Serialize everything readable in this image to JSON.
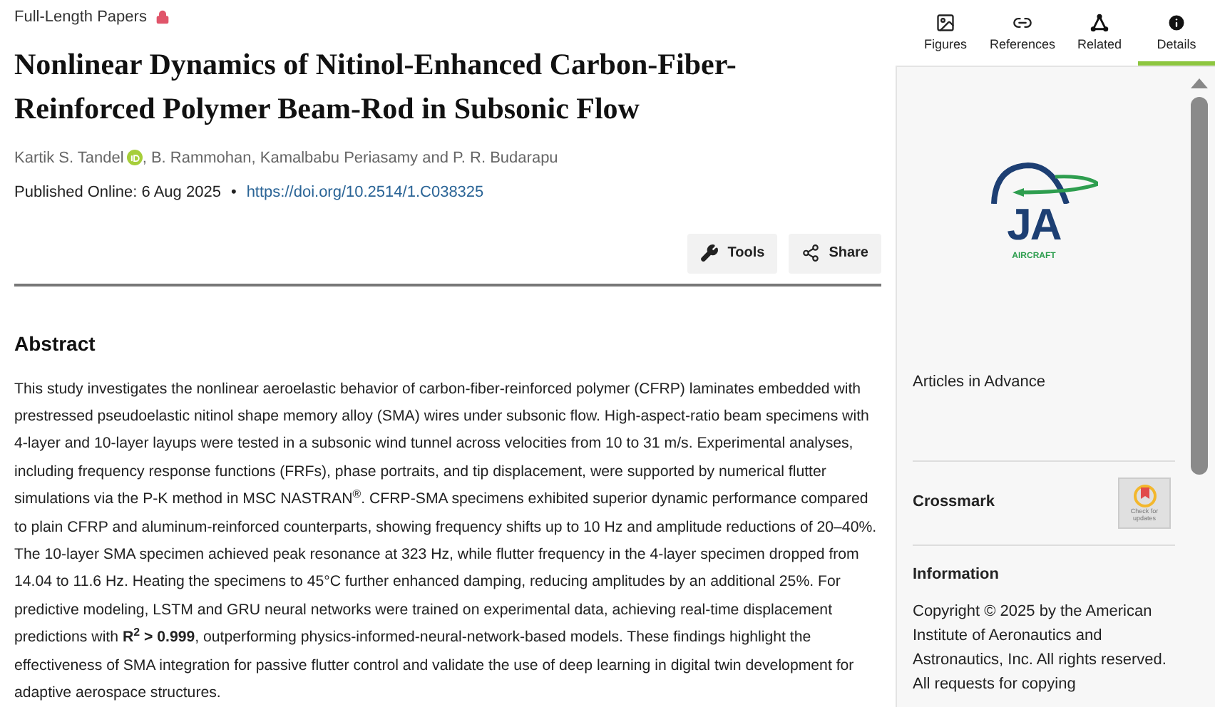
{
  "article": {
    "section": "Full-Length Papers",
    "locked": true,
    "title": "Nonlinear Dynamics of Nitinol-Enhanced Carbon-Fiber-Reinforced Polymer Beam-Rod in Subsonic Flow",
    "authors": [
      {
        "text": "Kartik S. Tandel",
        "orcid": true
      },
      {
        "text": ", B. Rammohan, Kamalbabu Periasamy and P. R. Budarapu",
        "orcid": false
      }
    ],
    "published": "Published Online: 6 Aug 2025",
    "separator": "•",
    "doi": "https://doi.org/10.2514/1.C038325",
    "actions": [
      {
        "label": "Tools",
        "kind": "wrench"
      },
      {
        "label": "Share",
        "kind": "share"
      }
    ],
    "abstract_heading": "Abstract",
    "abstract": "This study investigates the nonlinear aeroelastic behavior of carbon-fiber-reinforced polymer (CFRP) laminates embedded with prestressed pseudoelastic nitinol shape memory alloy (SMA) wires under subsonic flow. High-aspect-ratio beam specimens with 4-layer and 10-layer layups were tested in a subsonic wind tunnel across velocities from 10 to 31 m/s. Experimental analyses, including frequency response functions (FRFs), phase portraits, and tip displacement, were supported by numerical flutter simulations via the P-K method in MSC NASTRAN$^{®}$. CFRP-SMA specimens exhibited superior dynamic performance compared to plain CFRP and aluminum-reinforced counterparts, showing frequency shifts up to 10 Hz and amplitude reductions of 20–40%. The 10-layer SMA specimen achieved peak resonance at 323 Hz, while flutter frequency in the 4-layer specimen dropped from 14.04 to 11.6 Hz. Heating the specimens to 45°C further enhanced damping, reducing amplitudes by an additional 25%. For predictive modeling, LSTM and GRU neural networks were trained on experimental data, achieving real-time displacement predictions with **R$^{2}$ > 0.999**, outperforming physics-informed-neural-network-based models. These findings highlight the effectiveness of SMA integration for passive flutter control and validate the use of deep learning in digital twin development for adaptive aerospace structures."
  },
  "sidebar": {
    "tabs": [
      {
        "label": "Figures",
        "kind": "image",
        "selected": false
      },
      {
        "label": "References",
        "kind": "link",
        "selected": false
      },
      {
        "label": "Related",
        "kind": "network",
        "selected": false
      },
      {
        "label": "Details",
        "kind": "info",
        "selected": true
      }
    ],
    "journal_logo": {
      "letters": "JA",
      "name": "AIRCRAFT"
    },
    "status": "Articles in Advance",
    "crossmark": {
      "label": "Crossmark",
      "badge": "Check for updates"
    },
    "information_heading": "Information",
    "copyright": "Copyright © 2025 by the American Institute of Aeronautics and Astronautics, Inc. All rights reserved. All requests for copying"
  }
}
